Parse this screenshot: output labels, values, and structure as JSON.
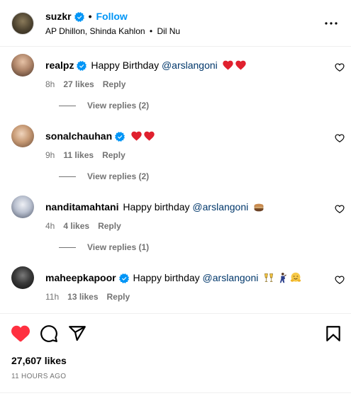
{
  "post": {
    "username": "suzkr",
    "follow_label": "Follow",
    "dot": "•",
    "audio_prefix": "AP Dhillon, Shinda Kahlon",
    "audio_track": "Dil Nu"
  },
  "comments": [
    {
      "username": "realpz",
      "text": "Happy Birthday",
      "mention": "@arslangoni",
      "emojis": [
        "red-heart",
        "red-heart"
      ],
      "time": "8h",
      "likes": "27 likes",
      "reply": "Reply",
      "view_replies": "View replies (2)",
      "avatar_colors": [
        "#c9a48a",
        "#6b4f3f"
      ]
    },
    {
      "username": "sonalchauhan",
      "text": "",
      "mention": "",
      "emojis": [
        "red-heart",
        "red-heart"
      ],
      "time": "9h",
      "likes": "11 likes",
      "reply": "Reply",
      "view_replies": "View replies (2)",
      "avatar_colors": [
        "#e8c7a8",
        "#a0724e"
      ]
    },
    {
      "username": "nanditamahtani",
      "text": "Happy birthday",
      "mention": "@arslangoni",
      "emojis": [
        "cake"
      ],
      "time": "4h",
      "likes": "4 likes",
      "reply": "Reply",
      "view_replies": "View replies (1)",
      "avatar_colors": [
        "#d9dde6",
        "#5b6478"
      ]
    },
    {
      "username": "maheepkapoor",
      "text": "Happy birthday",
      "mention": "@arslangoni",
      "emojis": [
        "clinking-glasses",
        "person-dancing",
        "hugging-face"
      ],
      "time": "11h",
      "likes": "13 likes",
      "reply": "Reply",
      "view_replies": "",
      "avatar_colors": [
        "#3a3a3a",
        "#101010"
      ]
    }
  ],
  "actions": {
    "like_icon": "heart-filled-icon",
    "comment_icon": "comment-icon",
    "share_icon": "share-icon",
    "save_icon": "bookmark-icon",
    "likes_total": "27,607 likes",
    "time_ago": "11 HOURS AGO"
  },
  "colors": {
    "accent": "#0095f6",
    "like_red": "#ff3040",
    "secondary_text": "#737373",
    "mention": "#00376b"
  }
}
